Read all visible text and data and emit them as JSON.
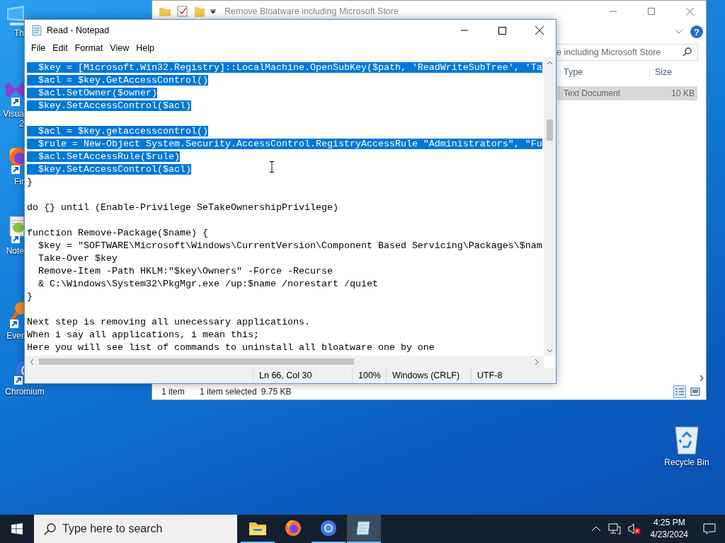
{
  "desktop_icons": [
    {
      "kind": "pc",
      "label": [
        "Th"
      ]
    },
    {
      "kind": "vs",
      "label": [
        "Visua",
        "2"
      ]
    },
    {
      "kind": "firefox",
      "label": [
        "Fir"
      ]
    },
    {
      "kind": "notepadpp",
      "label": [
        "Note"
      ]
    },
    {
      "kind": "everything",
      "label": [
        "Ever"
      ]
    },
    {
      "kind": "chromium",
      "label": [
        "Chromium"
      ]
    },
    {
      "kind": "recycle",
      "label": [
        "Recycle Bin"
      ]
    }
  ],
  "explorer": {
    "title": "Remove Bloatware including Microsoft Store",
    "help": "?",
    "search": {
      "placeholder": "e including Microsoft Store"
    },
    "columns": [
      "Type",
      "Size"
    ],
    "rows": [
      {
        "type": "Text Document",
        "size": "10 KB",
        "selected": true
      }
    ],
    "status": {
      "count": "1 item",
      "selection": "1 item selected",
      "size": "9.75 KB"
    },
    "views": [
      {
        "kind": "details",
        "selected": true
      },
      {
        "kind": "tiles",
        "selected": false
      }
    ]
  },
  "notepad": {
    "title": "Read - Notepad",
    "menu": [
      "File",
      "Edit",
      "Format",
      "View",
      "Help"
    ],
    "blocks": [
      {
        "lines": [
          {
            "text": "  $key = [Microsoft.Win32.Registry]::LocalMachine.OpenSubKey($path, 'ReadWriteSubTree', 'Ta",
            "selected": true
          },
          {
            "text": "  $acl = $key.GetAccessControl()",
            "selected": true
          },
          {
            "text": "  $acl.SetOwner($owner)",
            "selected": true
          },
          {
            "text": "  $key.SetAccessControl($acl)",
            "selected": true
          }
        ]
      },
      {
        "lines": [
          {
            "text": "  $acl = $key.getaccesscontrol()",
            "selected": true
          },
          {
            "text": "  $rule = New-Object System.Security.AccessControl.RegistryAccessRule \"Administrators\", \"Fu",
            "selected": true
          },
          {
            "text": "  $acl.SetAccessRule($rule)",
            "selected": true
          },
          {
            "text": "  $key.SetAccessControl($acl)",
            "selected": true
          },
          {
            "text": "}",
            "selected": false
          }
        ]
      },
      {
        "lines": [
          {
            "text": "do {} until (Enable-Privilege SeTakeOwnershipPrivilege)",
            "selected": false
          }
        ]
      },
      {
        "lines": [
          {
            "text": "function Remove-Package($name) {",
            "selected": false
          },
          {
            "text": "  $key = \"SOFTWARE\\Microsoft\\Windows\\CurrentVersion\\Component Based Servicing\\Packages\\$nam",
            "selected": false
          },
          {
            "text": "  Take-Over $key",
            "selected": false
          },
          {
            "text": "  Remove-Item -Path HKLM:\"$key\\Owners\" -Force -Recurse",
            "selected": false
          },
          {
            "text": "  & C:\\Windows\\System32\\PkgMgr.exe /up:$name /norestart /quiet",
            "selected": false
          },
          {
            "text": "}",
            "selected": false
          }
        ]
      },
      {
        "lines": [
          {
            "text": "Next step is removing all unecessary applications.",
            "selected": false
          },
          {
            "text": "When i say all applications, i mean this;",
            "selected": false
          },
          {
            "text": "Here you will see list of commands to uninstall all bloatware one by one",
            "selected": false
          }
        ]
      }
    ],
    "status": {
      "position": "Ln 66, Col 30",
      "zoom": "100%",
      "eol": "Windows (CRLF)",
      "encoding": "UTF-8"
    }
  },
  "taskbar": {
    "search": {
      "placeholder": "Type here to search"
    },
    "apps": [
      {
        "kind": "explorer",
        "open": true,
        "selected": false
      },
      {
        "kind": "firefox",
        "open": false,
        "selected": false
      },
      {
        "kind": "chromium",
        "open": true,
        "selected": false
      },
      {
        "kind": "notepad",
        "open": true,
        "selected": true
      }
    ],
    "volume": {
      "muted": true
    },
    "time": "4:25 PM",
    "date": "4/23/2024"
  }
}
